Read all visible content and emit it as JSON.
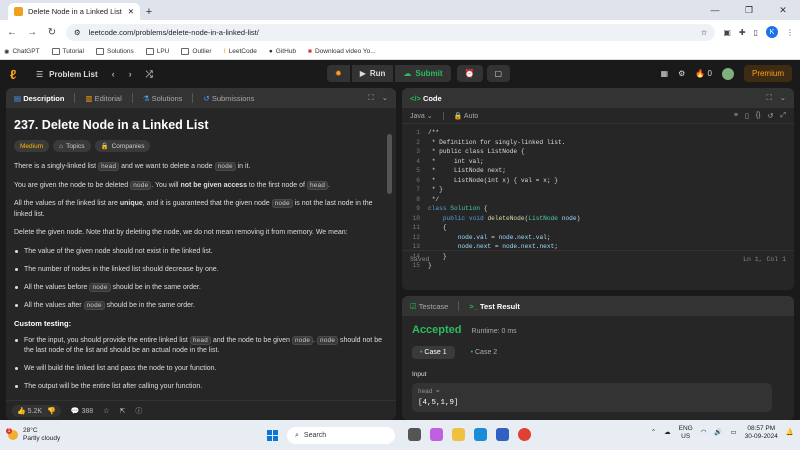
{
  "browser": {
    "tab_title": "Delete Node in a Linked List - L",
    "new_tab": "+",
    "url": "leetcode.com/problems/delete-node-in-a-linked-list/",
    "profile_initial": "K",
    "bookmarks": [
      "ChatGPT",
      "Tutorial",
      "Solutions",
      "LPU",
      "Outlier",
      "LeetCode",
      "GitHub",
      "Download video Yo..."
    ]
  },
  "lcnav": {
    "problem_list": "Problem List",
    "run": "Run",
    "submit": "Submit",
    "streak": "0",
    "premium": "Premium"
  },
  "left": {
    "tabs": [
      "Description",
      "Editorial",
      "Solutions",
      "Submissions"
    ],
    "title": "237. Delete Node in a Linked List",
    "chips": [
      "Medium",
      "Topics",
      "Companies"
    ],
    "p1": {
      "a": "There is a singly-linked list ",
      "c1": "head",
      "b": " and we want to delete a node ",
      "c2": "node",
      "d": " in it."
    },
    "p2": {
      "a": "You are given the node to be deleted ",
      "c1": "node",
      "b": ". You will ",
      "strong": "not be given access",
      "d": " to the first node of ",
      "c2": "head",
      "e": "."
    },
    "p3": {
      "a": "All the values of the linked list are ",
      "strong": "unique",
      "b": ", and it is guaranteed that the given node ",
      "c1": "node",
      "d": " is not the last node in the linked list."
    },
    "p4": "Delete the given node. Note that by deleting the node, we do not mean removing it from memory. We mean:",
    "bullets": {
      "b1": "The value of the given node should not exist in the linked list.",
      "b2": "The number of nodes in the linked list should decrease by one.",
      "b3a": "All the values before ",
      "b3c": "node",
      "b3b": " should be in the same order.",
      "b4a": "All the values after ",
      "b4c": "node",
      "b4b": " should be in the same order."
    },
    "custom_title": "Custom testing:",
    "custom": {
      "c1a": "For the input, you should provide the entire linked list ",
      "c1c1": "head",
      "c1b": " and the node to be given ",
      "c1c2": "node",
      "c1c3": "node",
      "c1d": " should not be the last node of the list and should be an actual node in the list.",
      "c2": "We will build the linked list and pass the node to your function.",
      "c3": "The output will be the entire list after calling your function."
    },
    "likes": "5.2K",
    "comments": "388"
  },
  "code": {
    "header": "Code",
    "language": "Java",
    "mode": "Auto",
    "saved": "Saved",
    "cursor": "Ln 1, Col 1",
    "lines": [
      "/**",
      " * Definition for singly-linked list.",
      " * public class ListNode {",
      " *     int val;",
      " *     ListNode next;",
      " *     ListNode(int x) { val = x; }",
      " * }",
      " */",
      "class Solution {",
      "    public void deleteNode(ListNode node)",
      "    {",
      "        node.val = node.next.val;",
      "        node.next = node.next.next;",
      "    }",
      "}"
    ]
  },
  "result": {
    "tabs": [
      "Testcase",
      "Test Result"
    ],
    "status": "Accepted",
    "runtime": "Runtime: 0 ms",
    "cases": [
      "Case 1",
      "Case 2"
    ],
    "input_label": "Input",
    "input_key": "head =",
    "input_value": "[4,5,1,9]"
  },
  "taskbar": {
    "temp": "28°C",
    "weather": "Partly cloudy",
    "search": "Search",
    "lang1": "ENG",
    "lang2": "US",
    "time": "08:57 PM",
    "date": "30-09-2024",
    "notif": "1"
  }
}
